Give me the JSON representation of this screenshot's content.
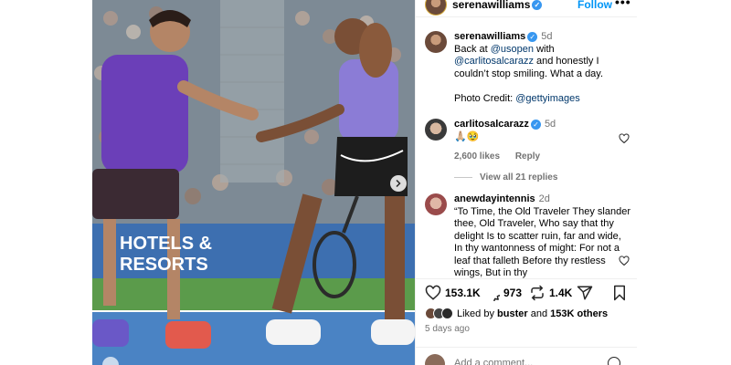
{
  "post": {
    "username": "serenawilliams",
    "follow_label": "Follow",
    "more_label": "•••",
    "caption": {
      "username": "serenawilliams",
      "time": "5d",
      "text_before": "Back at ",
      "mention_1": "@usopen",
      "text_mid": " with ",
      "mention_2": "@carlitosalcarazz",
      "text_after": " and honestly I couldn’t stop smiling. What a day.",
      "credit_label": "Photo Credit: ",
      "credit_mention": "@gettyimages"
    },
    "comments": [
      {
        "username": "carlitosalcarazz",
        "time": "5d",
        "text": "🙏🏼🥹",
        "likes": "2,600 likes",
        "reply_label": "Reply",
        "view_replies": "View all 21 replies"
      },
      {
        "username": "anewdayintennis",
        "time": "2d",
        "text": "“To Time, the Old Traveler They slander thee, Old Traveler, Who say that thy delight Is to scatter ruin, far and wide, In thy wantonness of might: For not a leaf that falleth Before thy restless wings, But in thy"
      }
    ],
    "actions": {
      "likes_count": "153.1K",
      "comments_count": "973",
      "reposts_count": "1.4K"
    },
    "liked_by": {
      "prefix": "Liked by ",
      "user": "buster",
      "mid": " and ",
      "count": "153K others"
    },
    "date": "5 days ago",
    "add_comment_placeholder": "Add a comment..."
  },
  "photo": {
    "banner_line_1": "HOTELS &",
    "banner_line_2": "RESORTS"
  },
  "colors": {
    "accent": "#0095f6",
    "verified": "#3897f0",
    "mention": "#00376b",
    "muted": "#737373"
  }
}
